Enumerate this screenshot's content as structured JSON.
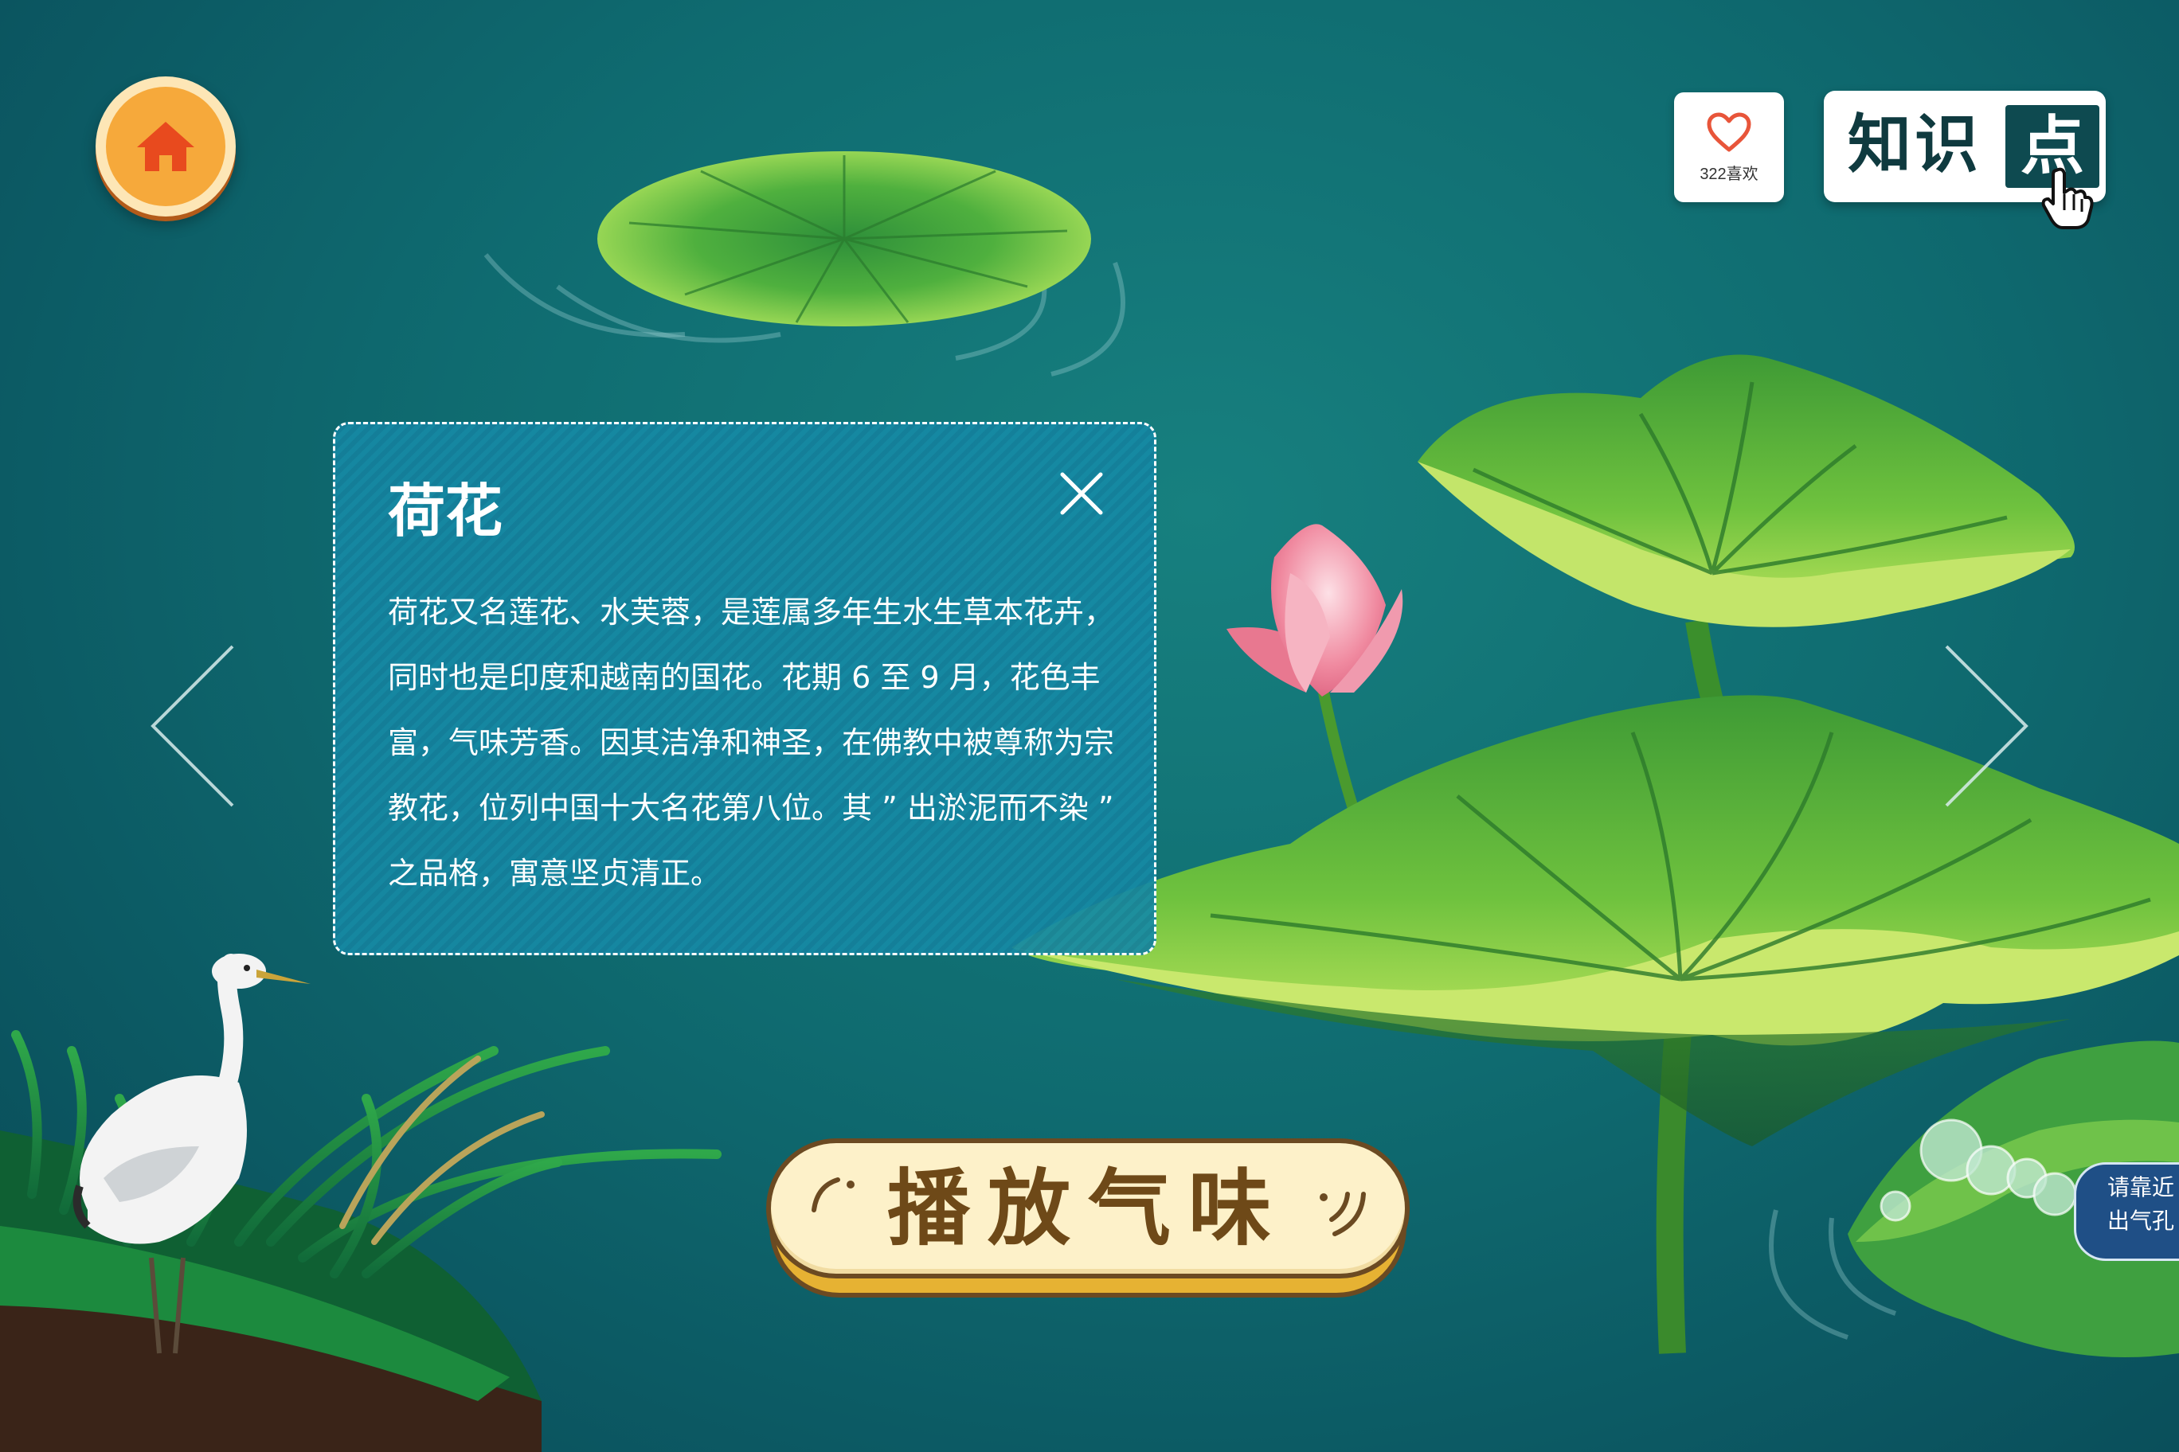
{
  "top_bar": {
    "home_icon": "home-icon",
    "like": {
      "icon": "heart-outline-icon",
      "count_label": "322喜欢"
    },
    "knowledge_button": {
      "label_left": "知识",
      "label_right": "点",
      "cursor_icon": "hand-pointer-icon"
    }
  },
  "navigation": {
    "prev_icon": "chevron-left-icon",
    "next_icon": "chevron-right-icon"
  },
  "info_card": {
    "title": "荷花",
    "close_icon": "close-icon",
    "body": "荷花又名莲花、水芙蓉，是莲属多年生水生草本花卉，同时也是印度和越南的国花。花期 6 至 9 月，花色丰富，气味芳香。因其洁净和神圣，在佛教中被尊称为宗教花，位列中国十大名花第八位。其 ” 出淤泥而不染 ” 之品格，寓意坚贞清正。"
  },
  "play_button": {
    "label": "播放气味"
  },
  "vent_hint": {
    "line1": "请靠近",
    "line2": "出气孔"
  },
  "colors": {
    "pond_water": "#0f6b70",
    "card_bg": "#168aa5",
    "home_orange": "#f6a93b",
    "lotus_leaf": "#5cb83a",
    "button_cream": "#fdf1c9",
    "button_text": "#6e4918",
    "heart": "#e8553a",
    "vent_blue": "#1f4f86"
  }
}
